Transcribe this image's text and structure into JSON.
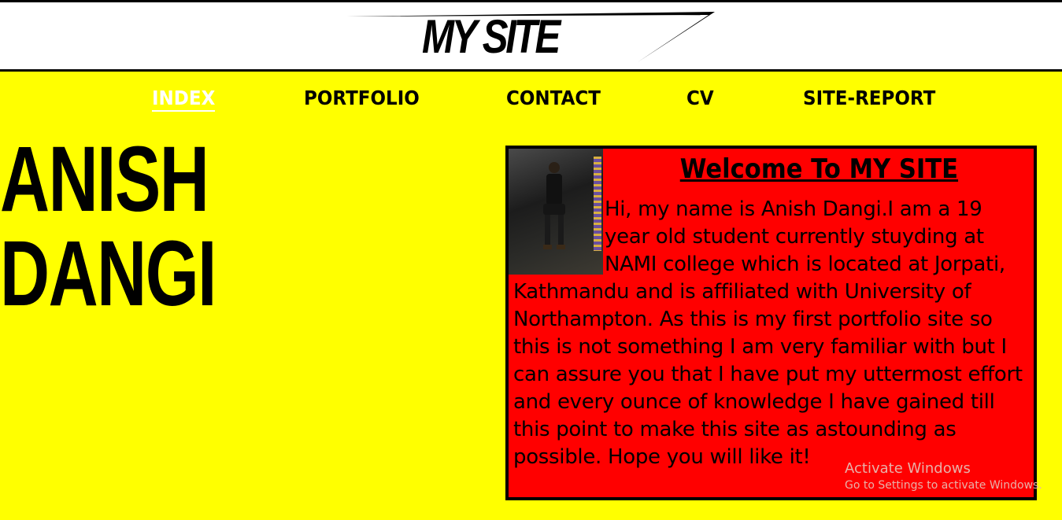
{
  "header": {
    "logo_text": "MY SITE"
  },
  "nav": {
    "items": [
      {
        "label": "INDEX",
        "active": true
      },
      {
        "label": "PORTFOLIO",
        "active": false
      },
      {
        "label": "CONTACT",
        "active": false
      },
      {
        "label": "CV",
        "active": false
      },
      {
        "label": "SITE-REPORT",
        "active": false
      }
    ]
  },
  "hero": {
    "first_name": "ANISH",
    "last_name": "DANGI"
  },
  "card": {
    "title": "Welcome To MY SITE",
    "body": "Hi, my name is Anish Dangi.I am a 19 year old student currently stuyding at NAMI college which is located at Jorpati, Kathmandu and is affiliated with University of Northampton. As this is my first portfolio site so this is not something I am very familiar with but I can assure you that I have put my uttermost effort and every ounce of knowledge I have gained till this point to make this site as astounding as possible. Hope you will like it!"
  },
  "watermark": {
    "line1": "Activate Windows",
    "line2": "Go to Settings to activate Windows."
  },
  "colors": {
    "background": "#ffff00",
    "card": "#ff0000",
    "header": "#ffffff",
    "active_nav": "#ffffff"
  }
}
